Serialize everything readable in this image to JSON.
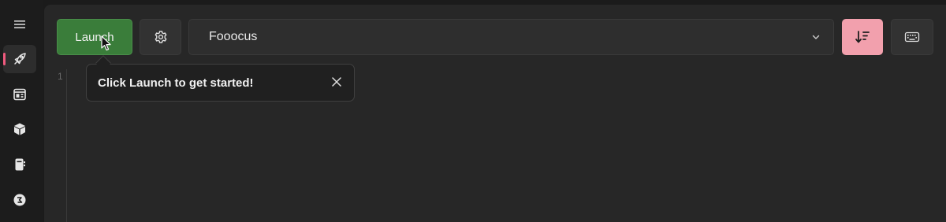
{
  "sidebar": {
    "items": [
      {
        "icon": "hamburger-menu-icon"
      },
      {
        "icon": "rocket-icon",
        "active": true
      },
      {
        "icon": "browser-window-icon"
      },
      {
        "icon": "package-box-icon"
      },
      {
        "icon": "notebook-icon"
      },
      {
        "icon": "civitai-icon"
      }
    ],
    "accent_color": "#f05a7e"
  },
  "toolbar": {
    "launch_label": "Launch",
    "launch_color": "#3a7d3a",
    "settings_icon": "gear-icon",
    "package_select": {
      "selected": "Fooocus"
    },
    "sort_icon": "sort-descending-icon",
    "sort_button_color": "#f2a0ad",
    "keyboard_icon": "keyboard-icon"
  },
  "console": {
    "line_number": "1"
  },
  "teaching_tip": {
    "message": "Click Launch to get started!",
    "close_icon": "close-icon"
  }
}
